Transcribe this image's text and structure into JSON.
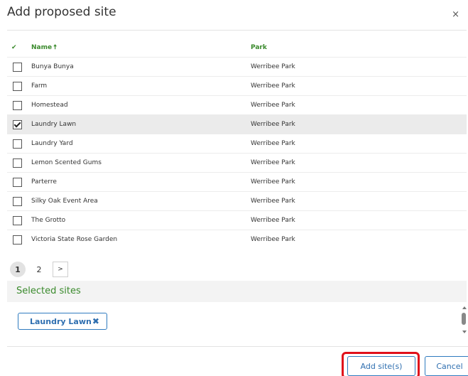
{
  "dialog": {
    "title": "Add proposed site",
    "close_symbol": "×"
  },
  "table": {
    "check_header": "✔",
    "columns": [
      "Name",
      "Park"
    ],
    "sort_indicator": "🠅",
    "rows": [
      {
        "name": "Bunya Bunya",
        "park": "Werribee Park",
        "checked": false
      },
      {
        "name": "Farm",
        "park": "Werribee Park",
        "checked": false
      },
      {
        "name": "Homestead",
        "park": "Werribee Park",
        "checked": false
      },
      {
        "name": "Laundry Lawn",
        "park": "Werribee Park",
        "checked": true
      },
      {
        "name": "Laundry Yard",
        "park": "Werribee Park",
        "checked": false
      },
      {
        "name": "Lemon Scented Gums",
        "park": "Werribee Park",
        "checked": false
      },
      {
        "name": "Parterre",
        "park": "Werribee Park",
        "checked": false
      },
      {
        "name": "Silky Oak Event Area",
        "park": "Werribee Park",
        "checked": false
      },
      {
        "name": "The Grotto",
        "park": "Werribee Park",
        "checked": false
      },
      {
        "name": "Victoria State Rose Garden",
        "park": "Werribee Park",
        "checked": false
      }
    ]
  },
  "pagination": {
    "pages": [
      "1",
      "2"
    ],
    "current": "1",
    "next_label": ">"
  },
  "selected_sites": {
    "heading": "Selected sites",
    "items": [
      {
        "label": "Laundry Lawn",
        "remove_symbol": "✖"
      }
    ]
  },
  "footer": {
    "add_label": "Add site(s)",
    "cancel_label": "Cancel"
  },
  "colors": {
    "accent_green": "#3a8a2c",
    "accent_blue": "#2f6fb0",
    "highlight_red": "#e0101b"
  }
}
